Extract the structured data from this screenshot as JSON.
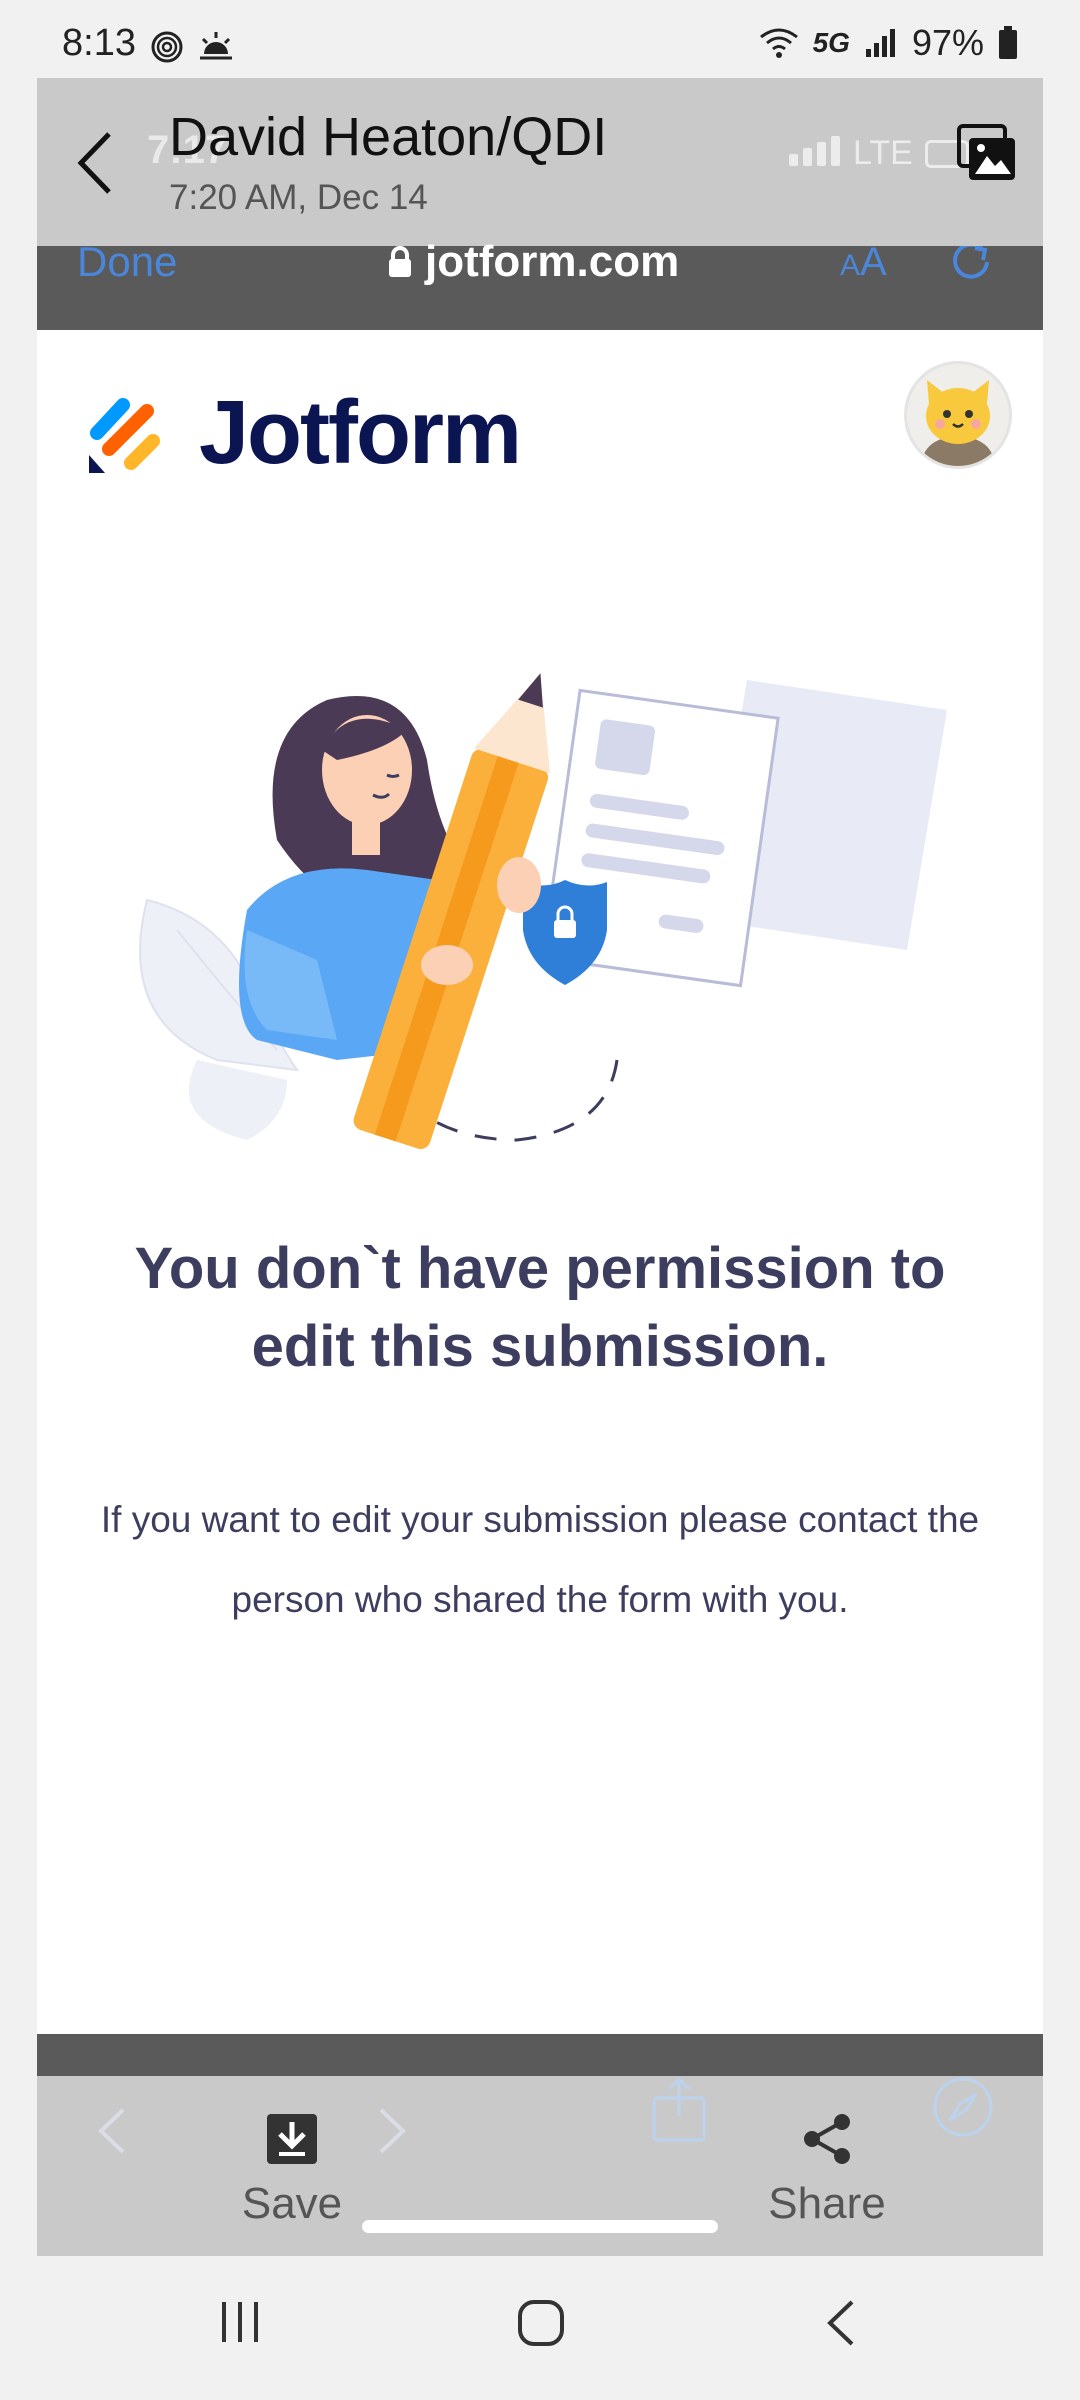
{
  "status_bar": {
    "time": "8:13",
    "network": "5G",
    "battery": "97%",
    "icons": [
      "fingerprint-icon",
      "weather-icon",
      "wifi-icon",
      "signal-icon",
      "battery-icon"
    ]
  },
  "message_header": {
    "sender": "David Heaton/QDI",
    "timestamp": "7:20 AM, Dec 14",
    "ghost_time": "7:17",
    "ghost_network": "LTE"
  },
  "browser": {
    "done_label": "Done",
    "url": "jotform.com",
    "text_size_label": "AA"
  },
  "page": {
    "brand": "Jotform",
    "heading": "You don`t have permission to edit this submission.",
    "description": "If you want to edit your submission please contact the person who shared the form with you."
  },
  "share_actions": {
    "save_label": "Save",
    "share_label": "Share"
  },
  "colors": {
    "link_blue": "#4a86d9",
    "heading_text": "#3d3d5f",
    "brand_navy": "#0a1551",
    "pencil_orange": "#fbb03b",
    "shirt_blue": "#5aa8f5"
  }
}
